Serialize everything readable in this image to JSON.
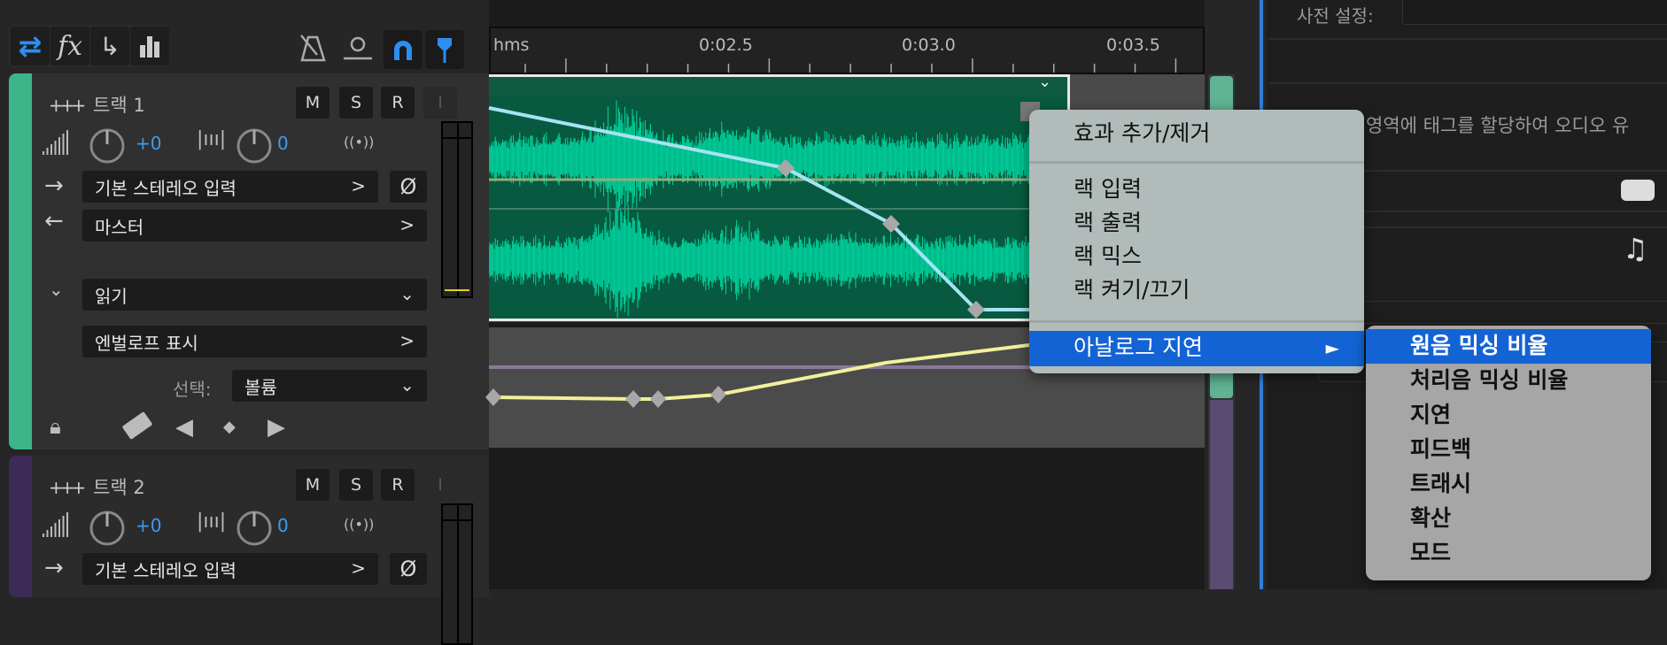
{
  "toolbar": {
    "buttons": [
      "switch-icon",
      "fx-icon",
      "send-icon",
      "levels-icon"
    ],
    "fx_label": "fx"
  },
  "ruler": {
    "labels": [
      "hms",
      "0:02.5",
      "0:03.0",
      "0:03.5"
    ]
  },
  "tracks": [
    {
      "name": "트랙 1",
      "color": "#3db58a",
      "m": "M",
      "s": "S",
      "r": "R",
      "i": "I",
      "volume": "+0",
      "pan": "0",
      "input": "기본 스테레오 입력",
      "output": "마스터",
      "automation_mode": "읽기",
      "envelope": "엔벌로프 표시",
      "select_label": "선택:",
      "select_value": "볼륨"
    },
    {
      "name": "트랙 2",
      "color": "#3b2b55",
      "m": "M",
      "s": "S",
      "r": "R",
      "i": "I",
      "volume": "+0",
      "pan": "0",
      "input": "기본 스테레오 입력"
    }
  ],
  "phase_symbol": "Ø",
  "chevron": ">",
  "right_panel": {
    "preset_label": "사전 설정:",
    "hint_text": "영역에 태그를 할당하여 오디오 유"
  },
  "context_menu": {
    "items": [
      "효과 추가/제거",
      "랙 입력",
      "랙 출력",
      "랙 믹스",
      "랙 켜기/끄기",
      "아날로그 지연"
    ],
    "arrow": "►"
  },
  "submenu": {
    "items": [
      "원음 믹싱 비율",
      "처리음 믹싱 비율",
      "지연",
      "피드백",
      "트래시",
      "확산",
      "모드"
    ]
  }
}
